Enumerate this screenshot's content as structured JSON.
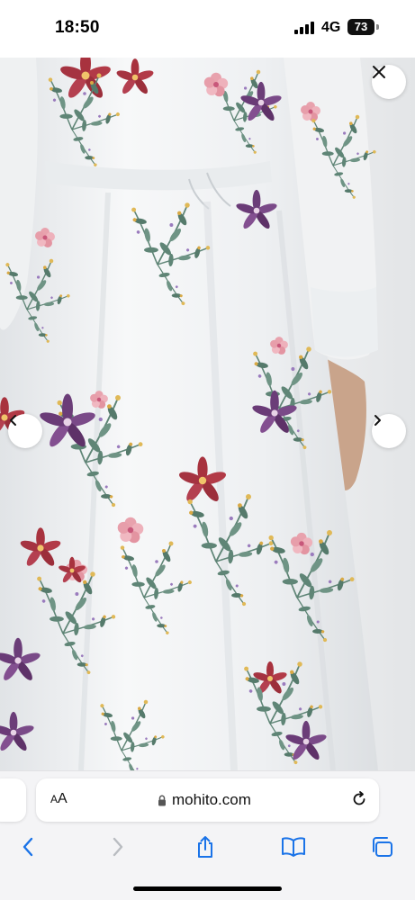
{
  "status_bar": {
    "time": "18:50",
    "network": "4G",
    "battery": "73"
  },
  "gallery": {
    "image_subject": "dress-photo",
    "close_icon": "close-icon",
    "prev_icon": "chevron-left-icon",
    "next_icon": "chevron-right-icon"
  },
  "browser": {
    "text_size_label_small": "A",
    "text_size_label_large": "A",
    "url": "mohito.com",
    "lock_icon": "lock-icon",
    "reload_icon": "reload-icon",
    "nav": {
      "back_icon": "back-icon",
      "forward_icon": "forward-icon",
      "share_icon": "share-icon",
      "bookmarks_icon": "bookmarks-icon",
      "tabs_icon": "tabs-icon"
    }
  },
  "colors": {
    "accent": "#1a73e8",
    "fabric": "#f3f4f5",
    "flower_red": "#a8323e",
    "flower_purple": "#6b3d78",
    "flower_pink": "#e49aa5",
    "leaf_green": "#5f8576"
  }
}
